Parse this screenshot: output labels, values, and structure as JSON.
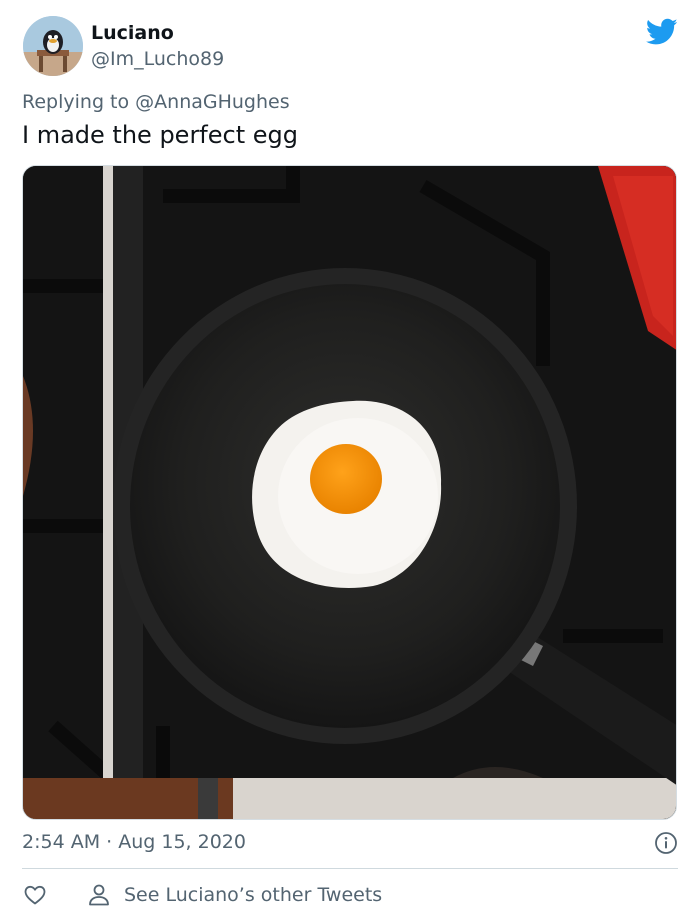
{
  "author": {
    "name": "Luciano",
    "handle": "@Im_Lucho89"
  },
  "reply": {
    "prefix": "Replying to ",
    "mention": "@AnnaGHughes"
  },
  "tweet": {
    "text": "I made the perfect egg"
  },
  "meta": {
    "timestamp": "2:54 AM · Aug 15, 2020"
  },
  "footer": {
    "other_tweets_label": "See Luciano’s other Tweets"
  },
  "icons": {
    "brand": "twitter-bird-icon",
    "info": "info-icon",
    "like": "heart-icon",
    "profile": "person-icon"
  },
  "colors": {
    "brand_blue": "#1d9bf0",
    "secondary_text": "#536471",
    "primary_text": "#0f1419",
    "divider": "#cfd9de"
  }
}
